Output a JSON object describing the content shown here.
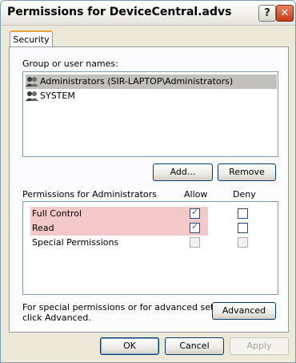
{
  "window": {
    "title": "Permissions for DeviceCentral.advs",
    "help_label": "?",
    "close_label": "✕"
  },
  "tabs": [
    {
      "label": "Security"
    }
  ],
  "group": {
    "label": "Group or user names:",
    "items": [
      {
        "name": "Administrators (SIR-LAPTOP\\Administrators)",
        "selected": true,
        "icon": "users-icon"
      },
      {
        "name": "SYSTEM",
        "selected": false,
        "icon": "users-icon"
      }
    ],
    "add_label": "Add...",
    "remove_label": "Remove"
  },
  "permissions": {
    "title": "Permissions for Administrators",
    "allow_label": "Allow",
    "deny_label": "Deny",
    "rows": [
      {
        "name": "Full Control",
        "allow": true,
        "deny": false,
        "highlighted": true
      },
      {
        "name": "Read",
        "allow": true,
        "deny": false,
        "highlighted": true
      },
      {
        "name": "Special Permissions",
        "allow": false,
        "deny": false,
        "highlighted": false
      }
    ]
  },
  "advanced": {
    "text_line1": "For special permissions or for advanced settings,",
    "text_line2": "click Advanced.",
    "button_label": "Advanced"
  },
  "footer": {
    "ok_label": "OK",
    "cancel_label": "Cancel",
    "apply_label": "Apply"
  },
  "colors": {
    "highlight": "#f4c9c9",
    "selection": "#c2c0bc",
    "close_button": "#c8391b"
  }
}
